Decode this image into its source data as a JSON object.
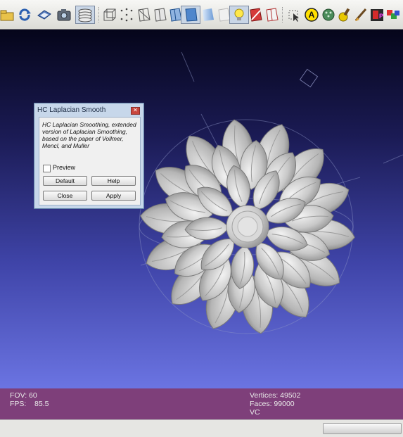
{
  "toolbar": {
    "buttons": [
      {
        "icon": "open-folder-icon"
      },
      {
        "icon": "reload-icon"
      },
      {
        "icon": "save-icon"
      },
      {
        "icon": "snapshot-camera-icon"
      },
      {
        "icon": "layers-icon",
        "pressed": true
      },
      {
        "icon": "bbox-icon"
      },
      {
        "icon": "points-icon"
      },
      {
        "icon": "wireframe-icon"
      },
      {
        "icon": "hidden-lines-icon"
      },
      {
        "icon": "flat-lines-icon"
      },
      {
        "icon": "flat-shading-icon",
        "pressed": true
      },
      {
        "icon": "smooth-shading-icon"
      },
      {
        "icon": "texture-icon"
      },
      {
        "icon": "light-bulb-icon",
        "pressed": true
      },
      {
        "icon": "backface-icon"
      },
      {
        "icon": "double-side-icon"
      },
      {
        "icon": "select-icon"
      },
      {
        "icon": "annotation-a-icon"
      },
      {
        "icon": "measure-icon"
      },
      {
        "icon": "paint-icon"
      },
      {
        "icon": "brush-icon"
      },
      {
        "icon": "color-picker-icon"
      },
      {
        "icon": "layers-color-icon"
      }
    ]
  },
  "dialog": {
    "title": "HC Laplacian Smooth",
    "description": "HC Laplacian Smoothing, extended version of Laplacian Smoothing, based on the paper of Vollmer, Mencl, and Muller",
    "preview_label": "Preview",
    "preview_checked": false,
    "default_label": "Default",
    "help_label": "Help",
    "close_label": "Close",
    "apply_label": "Apply"
  },
  "status": {
    "fov": "FOV: 60",
    "fps": "FPS:    85.5",
    "vertices": "Vertices: 49502",
    "faces": "Faces: 99000",
    "vc": "VC"
  },
  "colors": {
    "status_bar": "#7e3f7a",
    "viewport_top": "#05051a",
    "viewport_bottom": "#6b74e2",
    "mesh": "#cfcfcf"
  }
}
